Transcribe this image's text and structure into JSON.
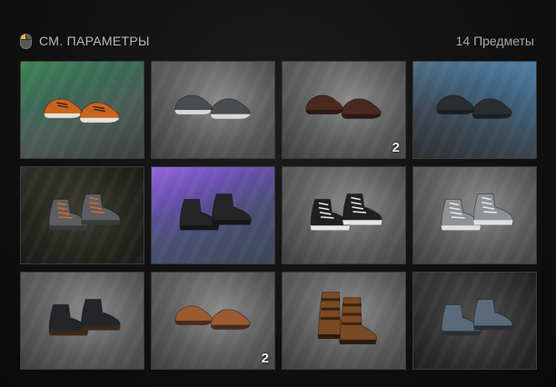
{
  "header": {
    "title": "СМ. ПАРАМЕТРЫ",
    "count": "14 Предметы",
    "icon": "mouse-icon"
  },
  "items": [
    {
      "name": "orange sneakers",
      "bg": "green",
      "color": "#c8641f",
      "sole": "#e8e2d6",
      "style": "sneaker",
      "badge": ""
    },
    {
      "name": "grey slip-ons",
      "bg": "grey",
      "color": "#4a4d50",
      "sole": "#d9d9d9",
      "style": "slipon",
      "badge": ""
    },
    {
      "name": "brown dress shoes",
      "bg": "grey",
      "color": "#4a2a1f",
      "sole": "#2a1a14",
      "style": "dress",
      "badge": "2"
    },
    {
      "name": "dark slip-ons",
      "bg": "blue",
      "color": "#2b2d31",
      "sole": "#1d1f22",
      "style": "slipon",
      "badge": ""
    },
    {
      "name": "grey high-tops orange laces",
      "bg": "dark",
      "color": "#5b5e62",
      "sole": "#3a3a3a",
      "style": "hightop",
      "badge": ""
    },
    {
      "name": "black combat boots",
      "bg": "purple",
      "color": "#252528",
      "sole": "#151515",
      "style": "boot",
      "badge": ""
    },
    {
      "name": "black high-top sneakers",
      "bg": "grey",
      "color": "#202023",
      "sole": "#e6e6e6",
      "style": "hightop",
      "badge": ""
    },
    {
      "name": "grey camo high-tops",
      "bg": "grey",
      "color": "#8c9296",
      "sole": "#e0e0e0",
      "style": "hightop",
      "badge": ""
    },
    {
      "name": "black engineer boots",
      "bg": "grey",
      "color": "#232528",
      "sole": "#3a2a1c",
      "style": "boot",
      "badge": ""
    },
    {
      "name": "tan oxfords",
      "bg": "grey",
      "color": "#9a5a32",
      "sole": "#4a2a18",
      "style": "dress",
      "badge": "2"
    },
    {
      "name": "brown buckle boots",
      "bg": "grey",
      "color": "#7a4a26",
      "sole": "#2a1c12",
      "style": "tallboot",
      "badge": ""
    },
    {
      "name": "blue-grey work boots",
      "bg": "darkgrey",
      "color": "#5a6a7a",
      "sole": "#2a2f35",
      "style": "boot",
      "badge": ""
    }
  ]
}
